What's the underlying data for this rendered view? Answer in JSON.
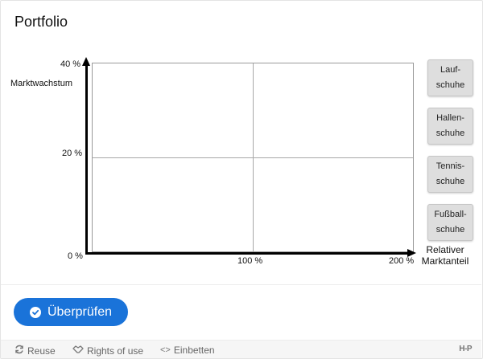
{
  "title": "Portfolio",
  "chart": {
    "ylabel": "Marktwachstum",
    "xlabel_line1": "Relativer",
    "xlabel_line2": "Marktanteil",
    "y_ticks": [
      "40 %",
      "20 %",
      "0 %"
    ],
    "x_ticks": [
      "100 %",
      "200 %"
    ]
  },
  "chart_data": {
    "type": "scatter",
    "title": "",
    "xlabel": "Relativer Marktanteil",
    "ylabel": "Marktwachstum",
    "xlim": [
      0,
      200
    ],
    "ylim": [
      0,
      40
    ],
    "x_ticks": [
      "100 %",
      "200 %"
    ],
    "y_ticks": [
      "0 %",
      "20 %",
      "40 %"
    ],
    "grid": true,
    "series": []
  },
  "tiles": [
    {
      "line1": "Lauf-",
      "line2": "schuhe"
    },
    {
      "line1": "Hallen-",
      "line2": "schuhe"
    },
    {
      "line1": "Tennis-",
      "line2": "schuhe"
    },
    {
      "line1": "Fußball-",
      "line2": "schuhe"
    }
  ],
  "check_button": {
    "label": "Überprüfen"
  },
  "footer": {
    "reuse": "Reuse",
    "rights": "Rights of use",
    "embed": "Einbetten",
    "logo": "H‑P"
  },
  "colors": {
    "accent": "#1a73d9",
    "tile_bg": "#dedede",
    "axis": "#000000",
    "grid": "#a8a8a8"
  }
}
